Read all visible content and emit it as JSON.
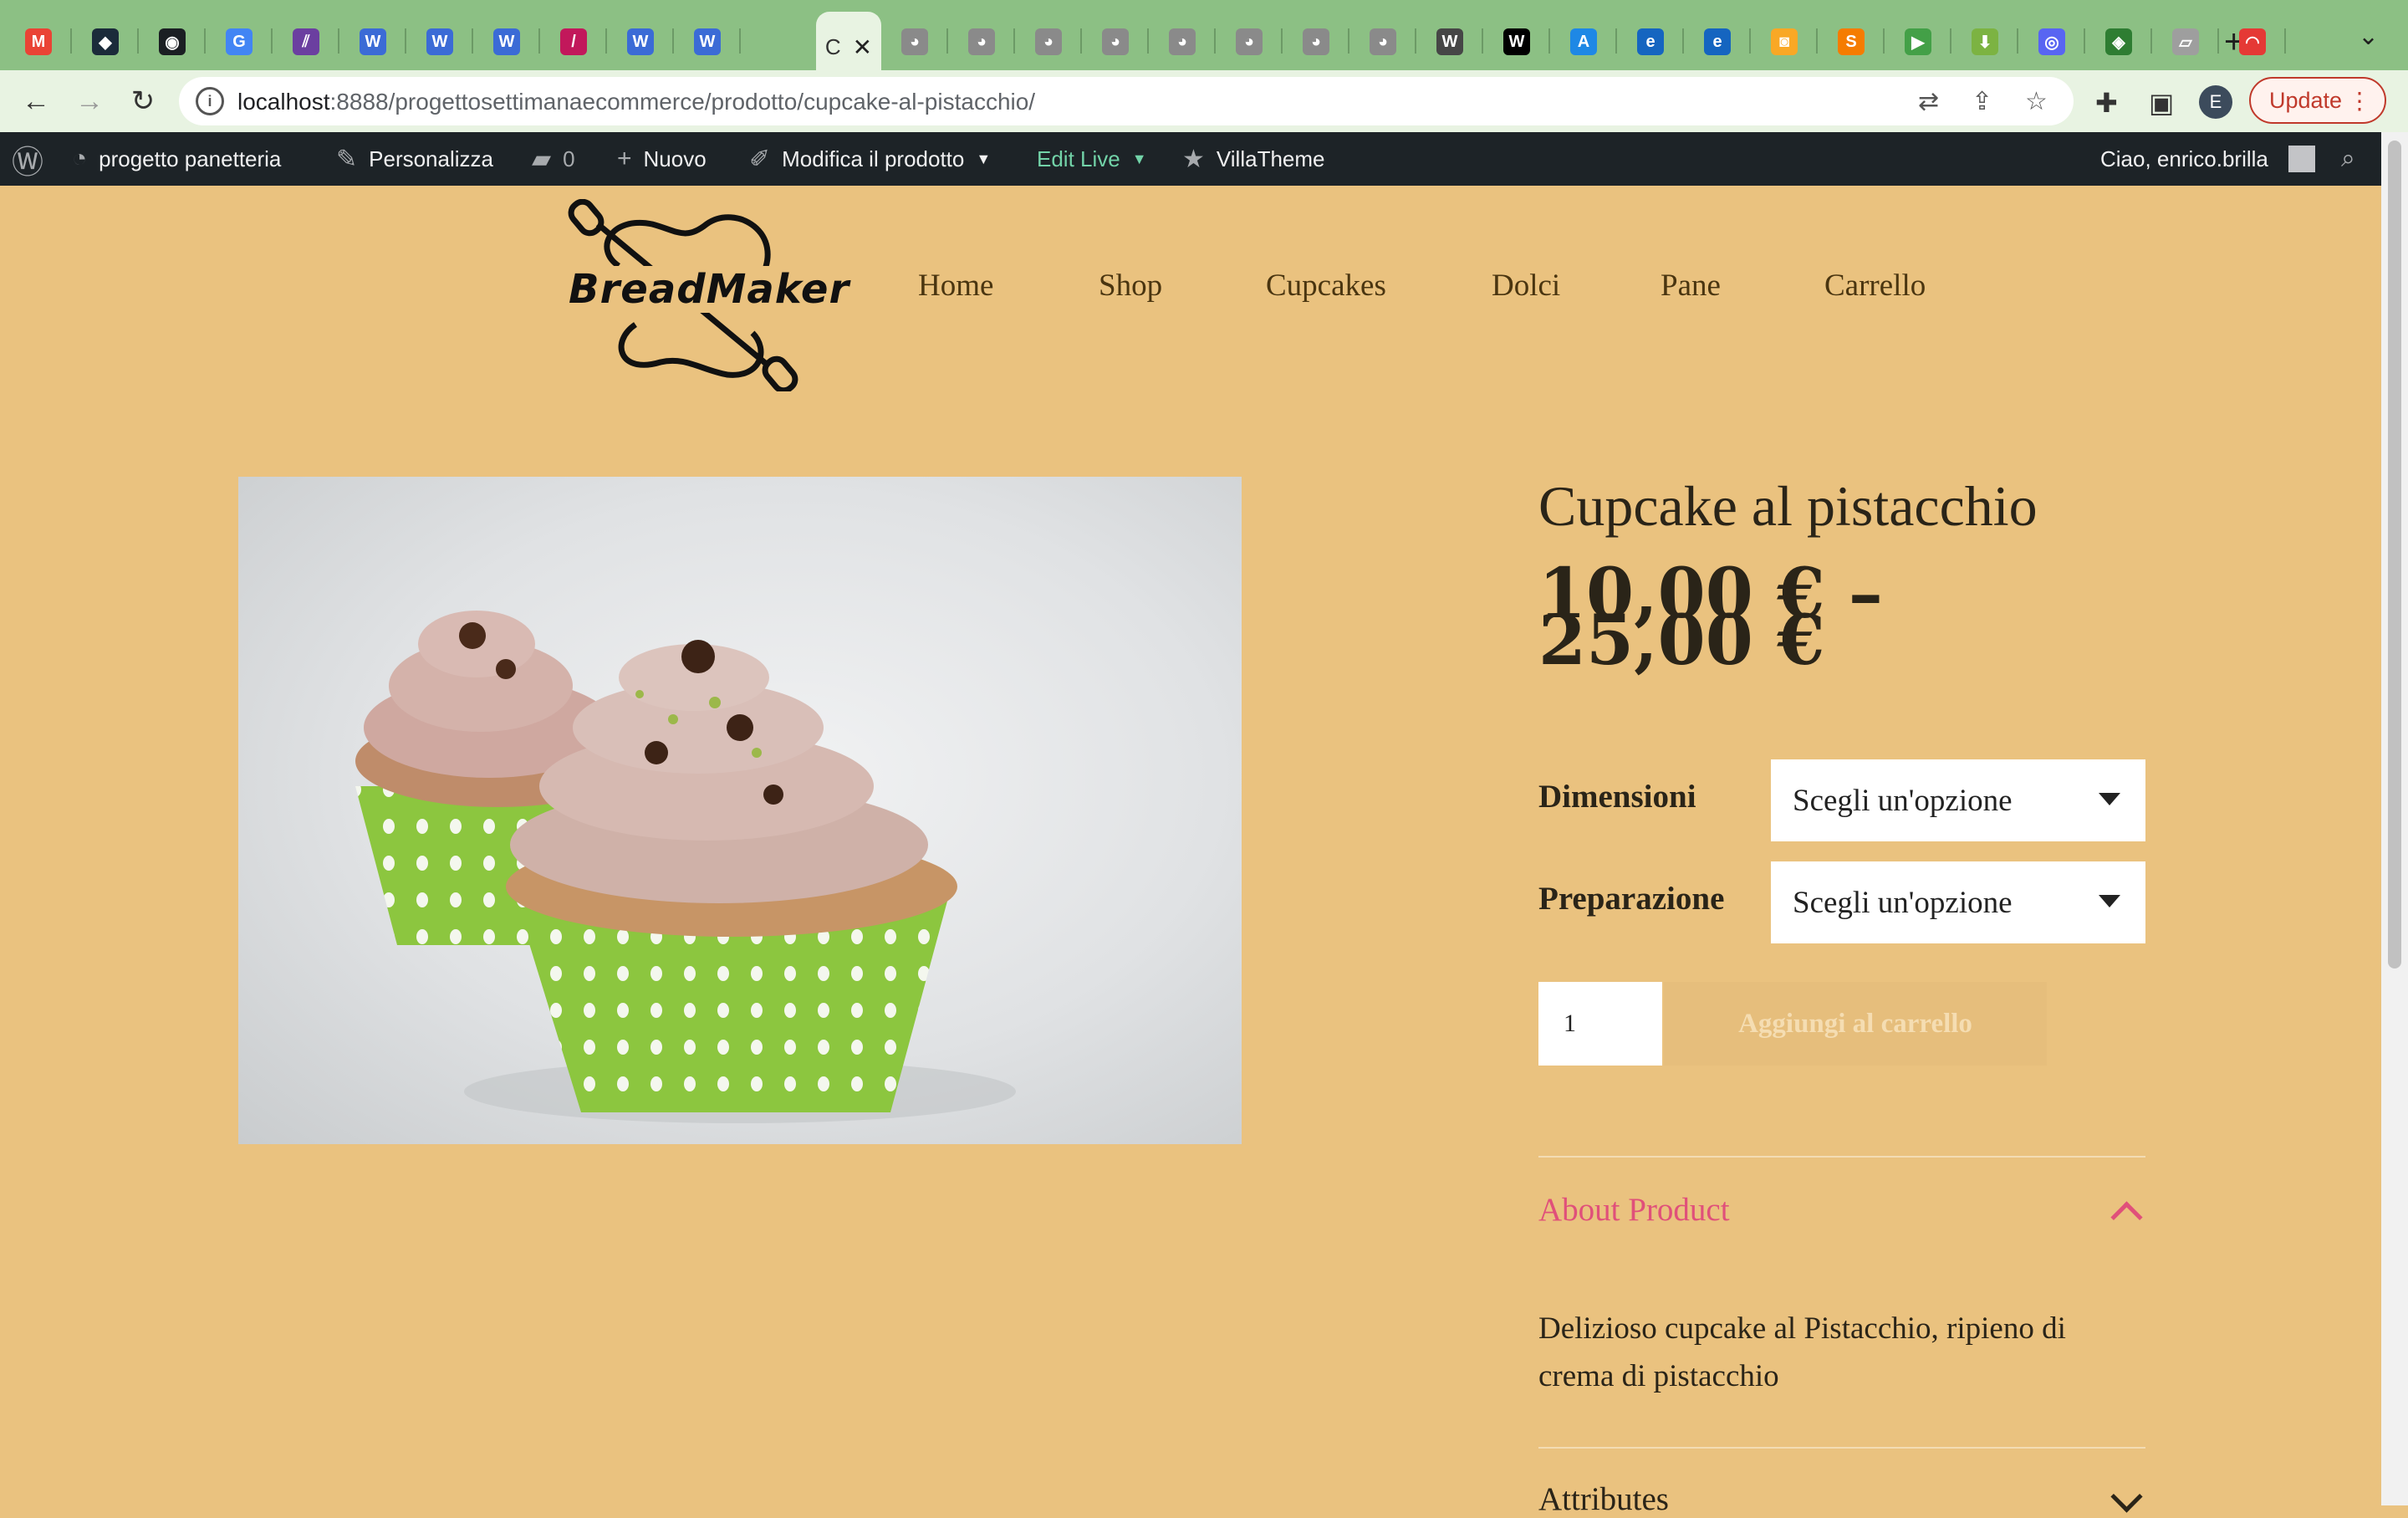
{
  "browser": {
    "tabs": [
      {
        "icon": "gmail-icon",
        "letter": "M",
        "color": "#ea4335"
      },
      {
        "icon": "hexagon-app-icon",
        "letter": "◆",
        "color": "#1b2b3a"
      },
      {
        "icon": "github-icon",
        "letter": "◉",
        "color": "#1b1f23"
      },
      {
        "icon": "google-icon",
        "letter": "G",
        "color": "#4285f4"
      },
      {
        "icon": "stripes-app-icon",
        "letter": "⫽",
        "color": "#6b3fa0"
      },
      {
        "icon": "webflow-icon",
        "letter": "W",
        "color": "#3b6bd6"
      },
      {
        "icon": "webflow-icon",
        "letter": "W",
        "color": "#3b6bd6"
      },
      {
        "icon": "webflow-icon",
        "letter": "W",
        "color": "#3b6bd6"
      },
      {
        "icon": "slash-app-icon",
        "letter": "/",
        "color": "#c2185b"
      },
      {
        "icon": "webflow-icon",
        "letter": "W",
        "color": "#3b6bd6"
      },
      {
        "icon": "webflow-icon",
        "letter": "W",
        "color": "#3b6bd6"
      },
      {
        "icon": "mamp-icon",
        "letter": "◕",
        "color": "#8a8a8a"
      },
      {
        "icon": "mamp-icon",
        "letter": "◕",
        "color": "#8a8a8a"
      },
      {
        "icon": "mamp-icon",
        "letter": "◕",
        "color": "#8a8a8a"
      },
      {
        "icon": "mamp-icon",
        "letter": "◕",
        "color": "#8a8a8a"
      },
      {
        "icon": "mamp-icon",
        "letter": "◕",
        "color": "#8a8a8a"
      },
      {
        "icon": "mamp-icon",
        "letter": "◕",
        "color": "#8a8a8a"
      },
      {
        "icon": "mamp-icon",
        "letter": "◕",
        "color": "#8a8a8a"
      },
      {
        "icon": "mamp-icon",
        "letter": "◕",
        "color": "#8a8a8a"
      },
      {
        "icon": "wordpress-icon",
        "letter": "W",
        "color": "#464646"
      },
      {
        "icon": "wikipedia-icon",
        "letter": "W",
        "color": "#000000"
      },
      {
        "icon": "app-store-icon",
        "letter": "A",
        "color": "#1e88e5"
      },
      {
        "icon": "edge-icon",
        "letter": "e",
        "color": "#1565c0"
      },
      {
        "icon": "edge-icon",
        "letter": "e",
        "color": "#1565c0"
      },
      {
        "icon": "orange-app-icon",
        "letter": "◙",
        "color": "#f9a825"
      },
      {
        "icon": "s-app-icon",
        "letter": "S",
        "color": "#f57c00"
      },
      {
        "icon": "play-icon",
        "letter": "▶",
        "color": "#43a047"
      },
      {
        "icon": "download-icon",
        "letter": "⬇",
        "color": "#7cb342"
      },
      {
        "icon": "discord-icon",
        "letter": "◎",
        "color": "#5865f2"
      },
      {
        "icon": "green-app-icon",
        "letter": "◈",
        "color": "#2e7d32"
      },
      {
        "icon": "image-icon",
        "letter": "▱",
        "color": "#9e9e9e"
      },
      {
        "icon": "rainbow-icon",
        "letter": "◠",
        "color": "#e53935"
      }
    ],
    "active_tab_label": "C",
    "url_host": "localhost",
    "url_rest": ":8888/progettosettimanaecommerce/prodotto/cupcake-al-pistacchio/",
    "profile_letter": "E",
    "update_label": "Update"
  },
  "adminbar": {
    "site_name": "progetto panetteria",
    "customize": "Personalizza",
    "comments_count": "0",
    "new": "Nuovo",
    "edit_product": "Modifica il prodotto",
    "edit_live": "Edit Live",
    "villatheme": "VillaTheme",
    "greeting": "Ciao, enrico.brilla"
  },
  "site": {
    "logo_text": "BreadMaker",
    "menu": [
      "Home",
      "Shop",
      "Cupcakes",
      "Dolci",
      "Pane",
      "Carrello"
    ]
  },
  "product": {
    "title": "Cupcake al pistacchio",
    "price_line1": "10,00 € –",
    "price_line2": "25,00 €",
    "attributes": [
      {
        "label": "Dimensioni",
        "placeholder": "Scegli un'opzione"
      },
      {
        "label": "Preparazione",
        "placeholder": "Scegli un'opzione"
      }
    ],
    "quantity": "1",
    "add_to_cart": "Aggiungi al carrello",
    "about_title": "About Product",
    "description": "Delizioso cupcake al Pistacchio, ripieno di crema di pistacchio",
    "attributes_title": "Attributes"
  },
  "colors": {
    "page_bg": "#EAC27F",
    "accent_pink": "#E0507A",
    "adminbar_bg": "#1D2327",
    "tabstrip_bg": "#8CC084"
  }
}
